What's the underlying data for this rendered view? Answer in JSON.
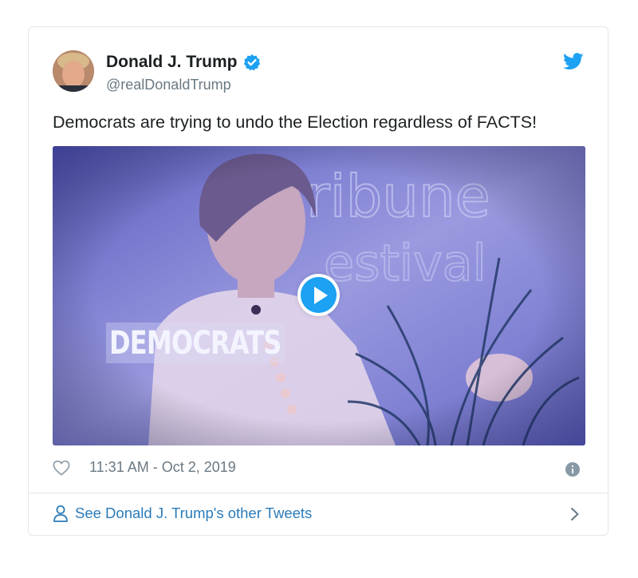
{
  "author": {
    "name": "Donald J. Trump",
    "handle": "@realDonaldTrump"
  },
  "tweet": {
    "text": "Democrats are trying to undo the Election regardless of FACTS!",
    "timestamp": "11:31 AM - Oct 2, 2019"
  },
  "media": {
    "overlay_text": "DEMOCRATS",
    "background_text_line1": "ribune",
    "background_text_line2": "estival"
  },
  "footer": {
    "link_label": "See Donald J. Trump's other Tweets"
  },
  "colors": {
    "brand_blue": "#1da1f2",
    "link_blue": "#2b7bb9",
    "muted_gray": "#697882",
    "border": "#e1e8ed"
  },
  "icons": [
    "verified-badge-icon",
    "twitter-bird-icon",
    "play-icon",
    "heart-icon",
    "info-icon",
    "person-icon",
    "chevron-right-icon"
  ]
}
